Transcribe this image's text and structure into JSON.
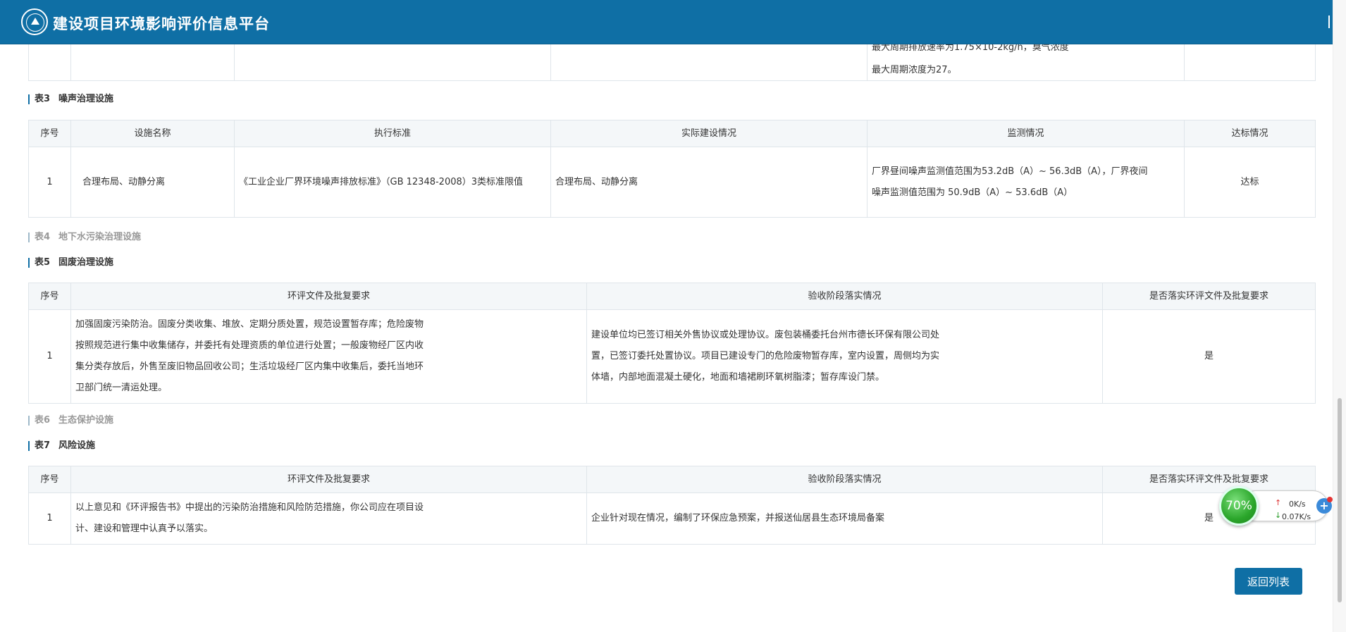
{
  "header": {
    "title": "建设项目环境影响评价信息平台"
  },
  "top_remnant": {
    "line_clipped": "最大周期排放速率为1.75×10-2kg/h，臭气浓度",
    "line_last": "最大周期浓度为27。"
  },
  "table3": {
    "title_num": "表3",
    "title": "噪声治理设施",
    "headers": [
      "序号",
      "设施名称",
      "执行标准",
      "实际建设情况",
      "监测情况",
      "达标情况"
    ],
    "rows": [
      {
        "no": "1",
        "name": "合理布局、动静分离",
        "standard": "《工业企业厂界环境噪声排放标准》（GB 12348-2008）3类标准限值",
        "actual": "合理布局、动静分离",
        "monitor": "厂界昼间噪声监测值范围为53.2dB（A）~ 56.3dB（A），厂界夜间噪声监测值范围为 50.9dB（A）~ 53.6dB（A）",
        "status": "达标"
      }
    ]
  },
  "table4": {
    "title_num": "表4",
    "title": "地下水污染治理设施"
  },
  "table5": {
    "title_num": "表5",
    "title": "固废治理设施",
    "headers": [
      "序号",
      "环评文件及批复要求",
      "验收阶段落实情况",
      "是否落实环评文件及批复要求"
    ],
    "rows": [
      {
        "no": "1",
        "requirement": "加强固废污染防治。固废分类收集、堆放、定期分质处置，规范设置暂存库；危险废物按照规范进行集中收集储存，并委托有处理资质的单位进行处置；一般废物经厂区内收集分类存放后，外售至废旧物品回收公司；生活垃圾经厂区内集中收集后，委托当地环卫部门统一清运处理。",
        "implementation": "建设单位均已签订相关外售协议或处理协议。废包装桶委托台州市德长环保有限公司处置，已签订委托处置协议。项目已建设专门的危险废物暂存库，室内设置，周侧均为实体墙，内部地面混凝土硬化，地面和墙裙刷环氧树脂漆；暂存库设门禁。",
        "fulfilled": "是"
      }
    ]
  },
  "table6": {
    "title_num": "表6",
    "title": "生态保护设施"
  },
  "table7": {
    "title_num": "表7",
    "title": "风险设施",
    "headers": [
      "序号",
      "环评文件及批复要求",
      "验收阶段落实情况",
      "是否落实环评文件及批复要求"
    ],
    "rows": [
      {
        "no": "1",
        "requirement": "以上意见和《环评报告书》中提出的污染防治措施和风险防范措施，你公司应在项目设计、建设和管理中认真予以落实。",
        "implementation": "企业针对现在情况，编制了环保应急预案，并报送仙居县生态环境局备案",
        "fulfilled": "是"
      }
    ]
  },
  "back_button": {
    "label": "返回列表"
  },
  "speed_widget": {
    "percent": "70%",
    "upload": "0K/s",
    "download": "0.07K/s",
    "up_arrow": "↑",
    "down_arrow": "↓",
    "plus": "+"
  },
  "colors": {
    "header_bg": "#0f6fa5",
    "table_header_bg": "#f4f7f9",
    "button_bg": "#0f6fa5"
  }
}
